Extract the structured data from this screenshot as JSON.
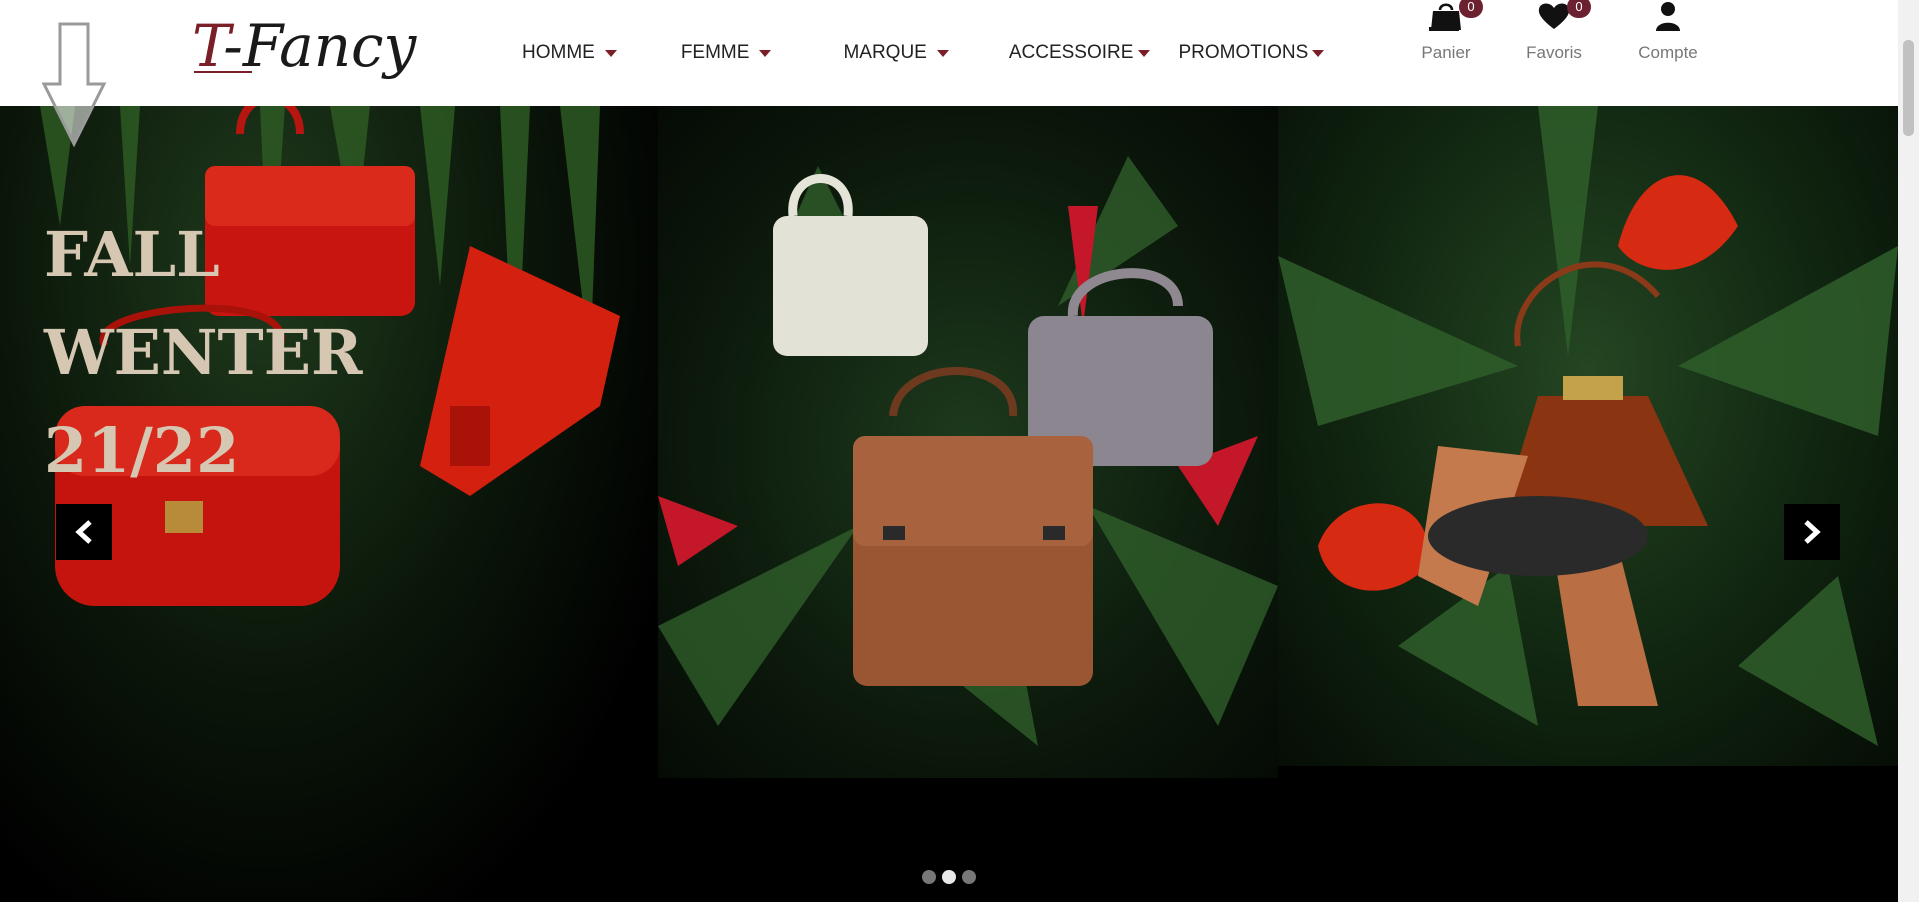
{
  "brand": {
    "logo_text": "T-Fancy",
    "logo_first": "T",
    "logo_rest": "-Fancy"
  },
  "nav": {
    "items": [
      {
        "label": "HOMME"
      },
      {
        "label": "FEMME"
      },
      {
        "label": "MARQUE"
      },
      {
        "label": "ACCESSOIRE"
      },
      {
        "label": "PROMOTIONS"
      }
    ]
  },
  "utilities": {
    "panier": {
      "label": "Panier",
      "count": "0",
      "icon": "shopping-bag-icon"
    },
    "favoris": {
      "label": "Favoris",
      "count": "0",
      "icon": "heart-icon"
    },
    "compte": {
      "label": "Compte",
      "icon": "user-icon"
    }
  },
  "hero": {
    "headline": [
      "FALL",
      "WENTER",
      "21/22"
    ],
    "prev_icon": "chevron-left-icon",
    "next_icon": "chevron-right-icon",
    "slides_total": 3,
    "active_slide": 2
  },
  "colors": {
    "accent": "#6b2130",
    "headline": "#d6c7b3",
    "nav_text": "#222222",
    "util_label": "#777777"
  }
}
